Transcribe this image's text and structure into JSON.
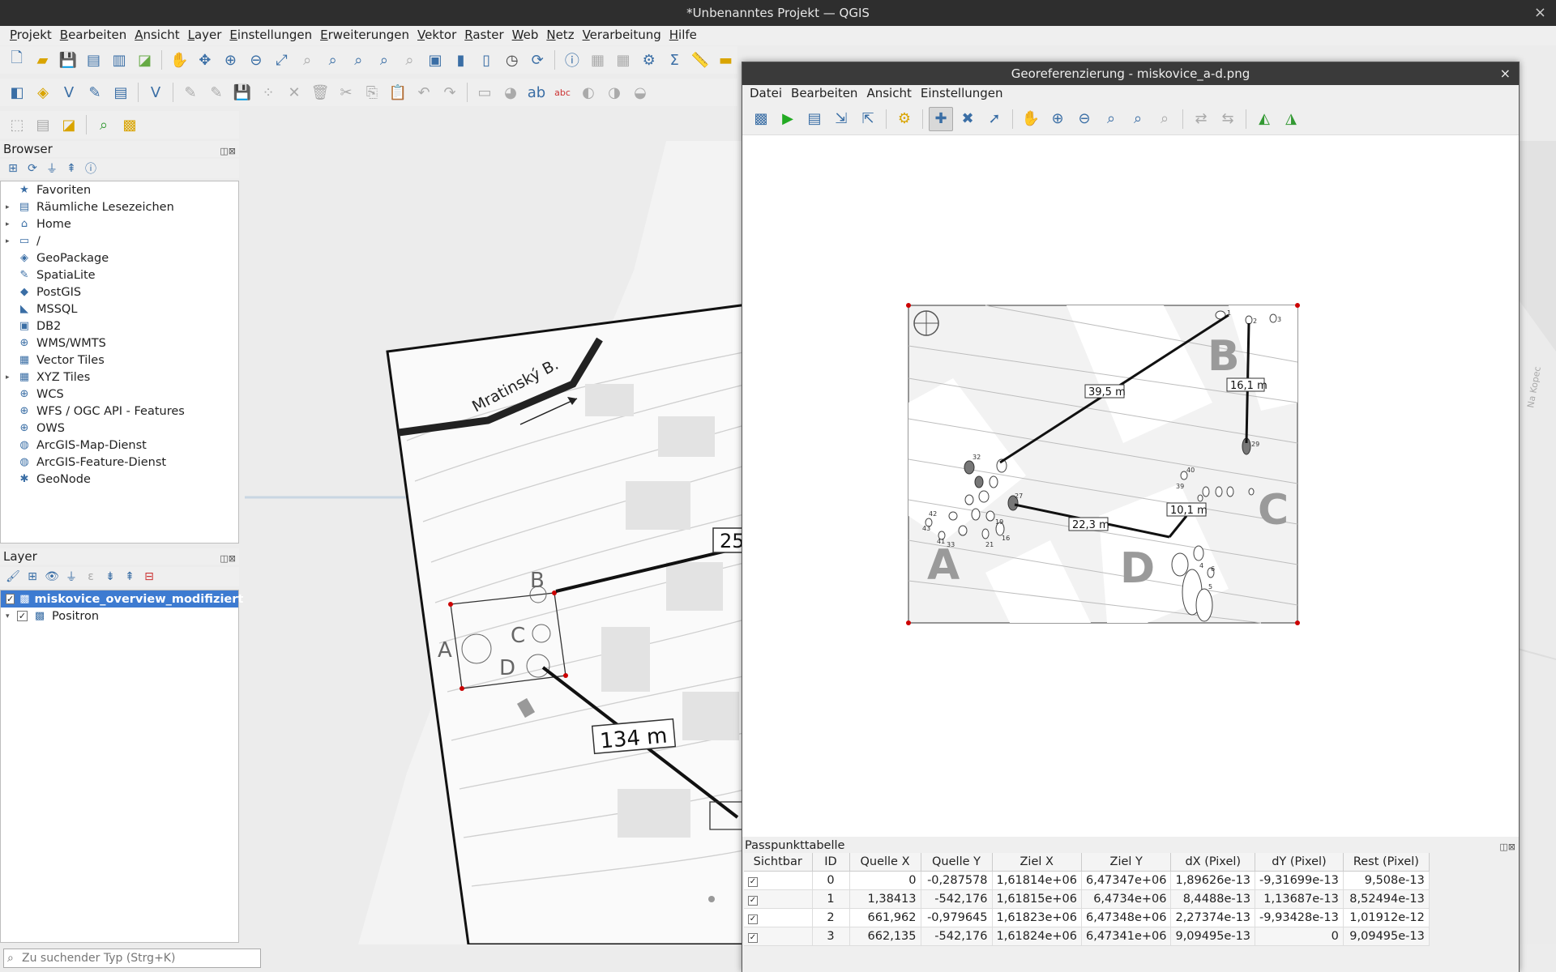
{
  "window": {
    "title": "*Unbenanntes Projekt — QGIS",
    "close": "×"
  },
  "menu": [
    "Projekt",
    "Bearbeiten",
    "Ansicht",
    "Layer",
    "Einstellungen",
    "Erweiterungen",
    "Vektor",
    "Raster",
    "Web",
    "Netz",
    "Verarbeitung",
    "Hilfe"
  ],
  "browser": {
    "title": "Browser",
    "items": [
      {
        "label": "Favoriten",
        "icon": "star-icon",
        "glyph": "★",
        "expand": ""
      },
      {
        "label": "Räumliche Lesezeichen",
        "icon": "bookmark-icon",
        "glyph": "▤",
        "expand": "▸"
      },
      {
        "label": "Home",
        "icon": "home-icon",
        "glyph": "⌂",
        "expand": "▸"
      },
      {
        "label": "/",
        "icon": "folder-icon",
        "glyph": "▭",
        "expand": "▸"
      },
      {
        "label": "GeoPackage",
        "icon": "geopackage-icon",
        "glyph": "◈",
        "expand": ""
      },
      {
        "label": "SpatiaLite",
        "icon": "feather-icon",
        "glyph": "✎",
        "expand": ""
      },
      {
        "label": "PostGIS",
        "icon": "elephant-icon",
        "glyph": "◆",
        "expand": ""
      },
      {
        "label": "MSSQL",
        "icon": "mssql-icon",
        "glyph": "◣",
        "expand": ""
      },
      {
        "label": "DB2",
        "icon": "db2-icon",
        "glyph": "▣",
        "expand": ""
      },
      {
        "label": "WMS/WMTS",
        "icon": "globe-icon",
        "glyph": "⊕",
        "expand": ""
      },
      {
        "label": "Vector Tiles",
        "icon": "grid-icon",
        "glyph": "▦",
        "expand": ""
      },
      {
        "label": "XYZ Tiles",
        "icon": "grid-icon",
        "glyph": "▦",
        "expand": "▸"
      },
      {
        "label": "WCS",
        "icon": "globe-icon",
        "glyph": "⊕",
        "expand": ""
      },
      {
        "label": "WFS / OGC API - Features",
        "icon": "globe-icon",
        "glyph": "⊕",
        "expand": ""
      },
      {
        "label": "OWS",
        "icon": "globe-icon",
        "glyph": "⊕",
        "expand": ""
      },
      {
        "label": "ArcGIS-Map-Dienst",
        "icon": "arcgis-icon",
        "glyph": "◍",
        "expand": ""
      },
      {
        "label": "ArcGIS-Feature-Dienst",
        "icon": "arcgis-icon",
        "glyph": "◍",
        "expand": ""
      },
      {
        "label": "GeoNode",
        "icon": "geonode-icon",
        "glyph": "✱",
        "expand": ""
      }
    ]
  },
  "layers": {
    "title": "Layer",
    "items": [
      {
        "label": "miskovice_overview_modifiziert",
        "checked": "✓",
        "expand": "",
        "selected": true
      },
      {
        "label": "Positron",
        "checked": "✓",
        "expand": "▾",
        "selected": false
      }
    ]
  },
  "search": {
    "placeholder": "Zu suchender Typ (Strg+K)"
  },
  "map": {
    "road_label": "Mratinský B.",
    "distance_134": "134 m",
    "distance_25": "25",
    "letters": [
      "A",
      "B",
      "C",
      "D"
    ]
  },
  "georef": {
    "title": "Georeferenzierung - miskovice_a-d.png",
    "menu": [
      "Datei",
      "Bearbeiten",
      "Ansicht",
      "Einstellungen"
    ],
    "image": {
      "letters": [
        "A",
        "B",
        "C",
        "D"
      ],
      "dist_395": "39,5 m",
      "dist_161": "16,1 m",
      "dist_223": "22,3 m",
      "dist_101": "10,1 m"
    },
    "gcp": {
      "title": "Passpunkttabelle",
      "columns": [
        "Sichtbar",
        "ID",
        "Quelle X",
        "Quelle Y",
        "Ziel X",
        "Ziel Y",
        "dX (Pixel)",
        "dY (Pixel)",
        "Rest (Pixel)"
      ],
      "rows": [
        {
          "visible": "✓",
          "id": "0",
          "qx": "0",
          "qy": "-0,287578",
          "zx": "1,61814e+06",
          "zy": "6,47347e+06",
          "dx": "1,89626e-13",
          "dy": "-9,31699e-13",
          "rest": "9,508e-13"
        },
        {
          "visible": "✓",
          "id": "1",
          "qx": "1,38413",
          "qy": "-542,176",
          "zx": "1,61815e+06",
          "zy": "6,4734e+06",
          "dx": "8,4488e-13",
          "dy": "1,13687e-13",
          "rest": "8,52494e-13"
        },
        {
          "visible": "✓",
          "id": "2",
          "qx": "661,962",
          "qy": "-0,979645",
          "zx": "1,61823e+06",
          "zy": "6,47348e+06",
          "dx": "2,27374e-13",
          "dy": "-9,93428e-13",
          "rest": "1,01912e-12"
        },
        {
          "visible": "✓",
          "id": "3",
          "qx": "662,135",
          "qy": "-542,176",
          "zx": "1,61824e+06",
          "zy": "6,47341e+06",
          "dx": "9,09495e-13",
          "dy": "0",
          "rest": "9,09495e-13"
        }
      ]
    }
  }
}
